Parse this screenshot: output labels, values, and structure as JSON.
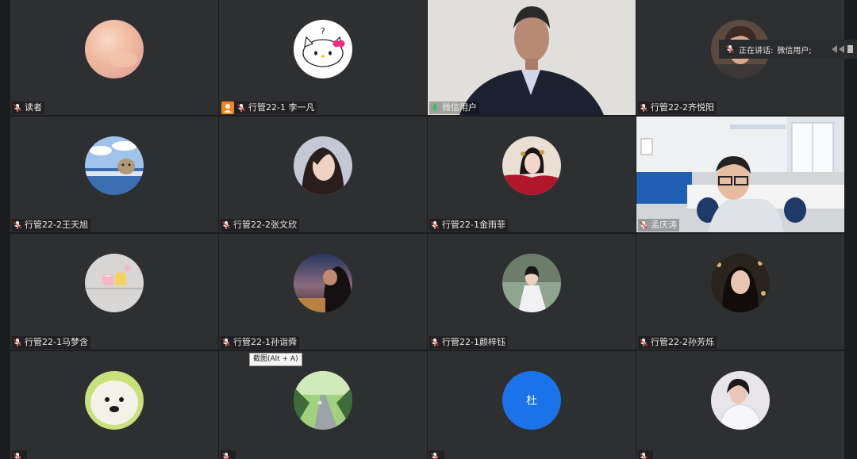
{
  "speaking_banner": {
    "prefix": "正在讲话:",
    "name": "微信用户;"
  },
  "tooltip": "截图(Alt + A)",
  "colors": {
    "tile_bg": "#2e2f31",
    "speaking_border": "#33c26a",
    "host_badge": "#f0851e",
    "letter_avatar": "#1a73e8"
  },
  "participants": [
    {
      "name": "读者",
      "mic": "muted",
      "avatar": "peach-gradient"
    },
    {
      "name": "行管22-1 李一凡",
      "mic": "muted",
      "host": true,
      "avatar": "hello-kitty"
    },
    {
      "name": "微信用户",
      "mic": "speaking",
      "video": true
    },
    {
      "name": "行管22-2齐悦阳",
      "mic": "muted",
      "avatar": "woman-photo"
    },
    {
      "name": "行管22-2王天旭",
      "mic": "muted",
      "avatar": "dog-sky"
    },
    {
      "name": "行管22-2张文欣",
      "mic": "muted",
      "avatar": "girl-portrait"
    },
    {
      "name": "行管22-1金雨菲",
      "mic": "muted",
      "avatar": "costume-portrait"
    },
    {
      "name": "孟庆涛",
      "mic": "muted",
      "video": true
    },
    {
      "name": "行管22-1马梦含",
      "mic": "muted",
      "avatar": "cartoon-cakes"
    },
    {
      "name": "行管22-1孙诣舜",
      "mic": "muted",
      "avatar": "sunset-man"
    },
    {
      "name": "行管22-1颜梓钰",
      "mic": "muted",
      "avatar": "girl-garden"
    },
    {
      "name": "行管22-2孙芳烁",
      "mic": "muted",
      "avatar": "girl-dark"
    },
    {
      "name": "",
      "mic": "muted",
      "avatar": "white-dog"
    },
    {
      "name": "",
      "mic": "muted",
      "avatar": "road-trees"
    },
    {
      "name": "",
      "mic": "muted",
      "avatar_letter": "杜"
    },
    {
      "name": "",
      "mic": "muted",
      "avatar": "person-white-shirt"
    }
  ]
}
